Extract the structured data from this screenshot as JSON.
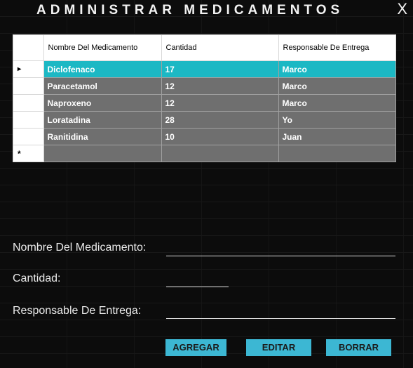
{
  "window": {
    "title": "ADMINISTRAR MEDICAMENTOS",
    "close_label": "X"
  },
  "grid": {
    "headers": [
      "Nombre Del Medicamento",
      "Cantidad",
      "Responsable De Entrega"
    ],
    "rows": [
      {
        "nombre": "Diclofenaco",
        "cantidad": "17",
        "responsable": "Marco"
      },
      {
        "nombre": "Paracetamol",
        "cantidad": "12",
        "responsable": "Marco"
      },
      {
        "nombre": "Naproxeno",
        "cantidad": "12",
        "responsable": "Marco"
      },
      {
        "nombre": "Loratadina",
        "cantidad": "28",
        "responsable": "Yo"
      },
      {
        "nombre": "Ranitidina",
        "cantidad": "10",
        "responsable": "Juan"
      }
    ],
    "current_row_marker": "▸",
    "new_row_marker": "*"
  },
  "form": {
    "nombre_label": "Nombre Del Medicamento:",
    "nombre_value": "",
    "cantidad_label": "Cantidad:",
    "cantidad_value": "",
    "responsable_label": "Responsable De Entrega:",
    "responsable_value": ""
  },
  "buttons": {
    "agregar": "AGREGAR",
    "editar": "EDITAR",
    "borrar": "BORRAR"
  },
  "colors": {
    "background": "#0c0c0c",
    "selected_row": "#1cb8c4",
    "row": "#6f6f6f",
    "button": "#3cb7d3"
  }
}
